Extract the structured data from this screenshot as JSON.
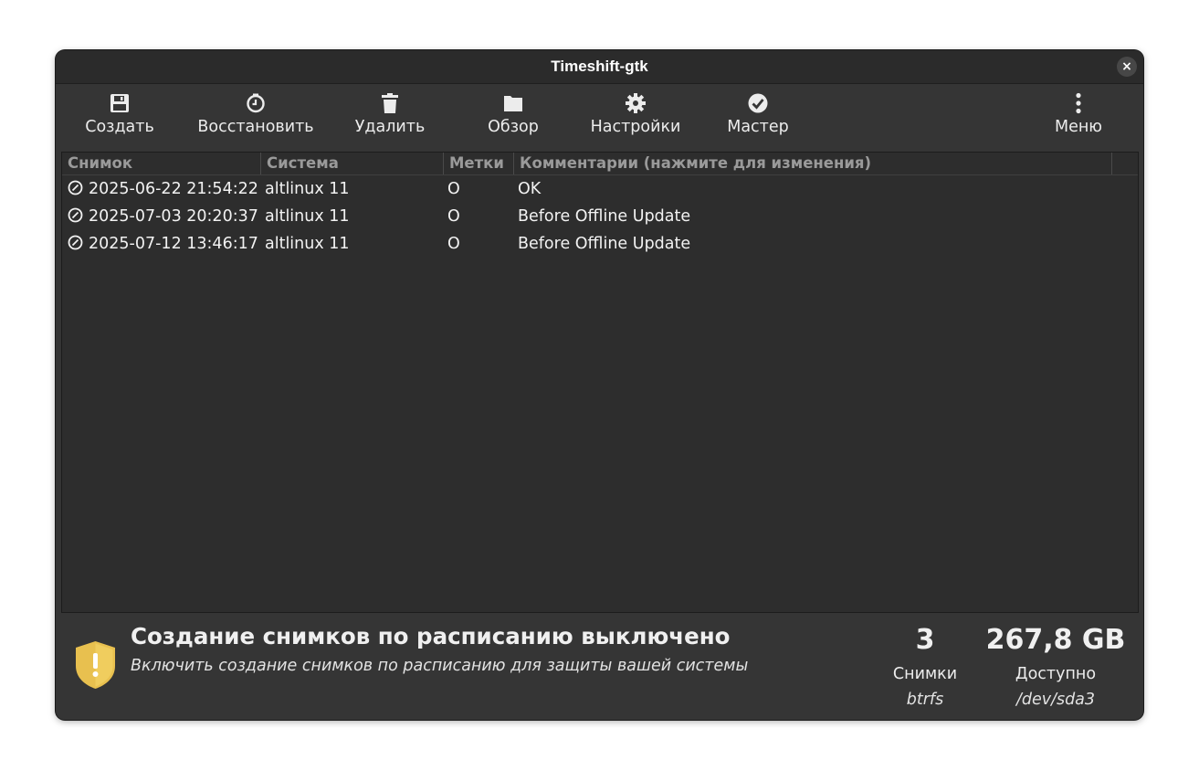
{
  "window": {
    "title": "Timeshift-gtk",
    "close_label": "×"
  },
  "toolbar": {
    "create": "Создать",
    "restore": "Восстановить",
    "delete": "Удалить",
    "browse": "Обзор",
    "settings": "Настройки",
    "wizard": "Мастер",
    "menu": "Меню"
  },
  "table": {
    "headers": {
      "snapshot": "Снимок",
      "system": "Система",
      "tags": "Метки",
      "comments": "Комментарии (нажмите для изменения)"
    },
    "rows": [
      {
        "snapshot": "2025-06-22 21:54:22",
        "system": "altlinux 11",
        "tags": "O",
        "comment": "OK"
      },
      {
        "snapshot": "2025-07-03 20:20:37",
        "system": "altlinux 11",
        "tags": "O",
        "comment": "Before Offline Update"
      },
      {
        "snapshot": "2025-07-12 13:46:17",
        "system": "altlinux 11",
        "tags": "O",
        "comment": "Before Offline Update"
      }
    ]
  },
  "status": {
    "title": "Создание снимков по расписанию выключено",
    "subtitle": "Включить создание снимков по расписанию для защиты вашей системы",
    "snapshots_count": "3",
    "snapshots_label": "Снимки",
    "filesystem": "btrfs",
    "available_size": "267,8 GB",
    "available_label": "Доступно",
    "device": "/dev/sda3"
  },
  "icons": {
    "create": "floppy-disk-icon",
    "restore": "clock-icon",
    "delete": "trash-icon",
    "browse": "folder-icon",
    "settings": "gear-icon",
    "wizard": "checkmark-circle-icon",
    "menu": "vertical-dots-icon",
    "row": "snapshot-status-icon",
    "status": "warning-shield-icon"
  },
  "colors": {
    "window_bg": "#353535",
    "titlebar_bg": "#2b2b2b",
    "list_bg": "#2d2d2d",
    "shield": "#e8c04f"
  }
}
